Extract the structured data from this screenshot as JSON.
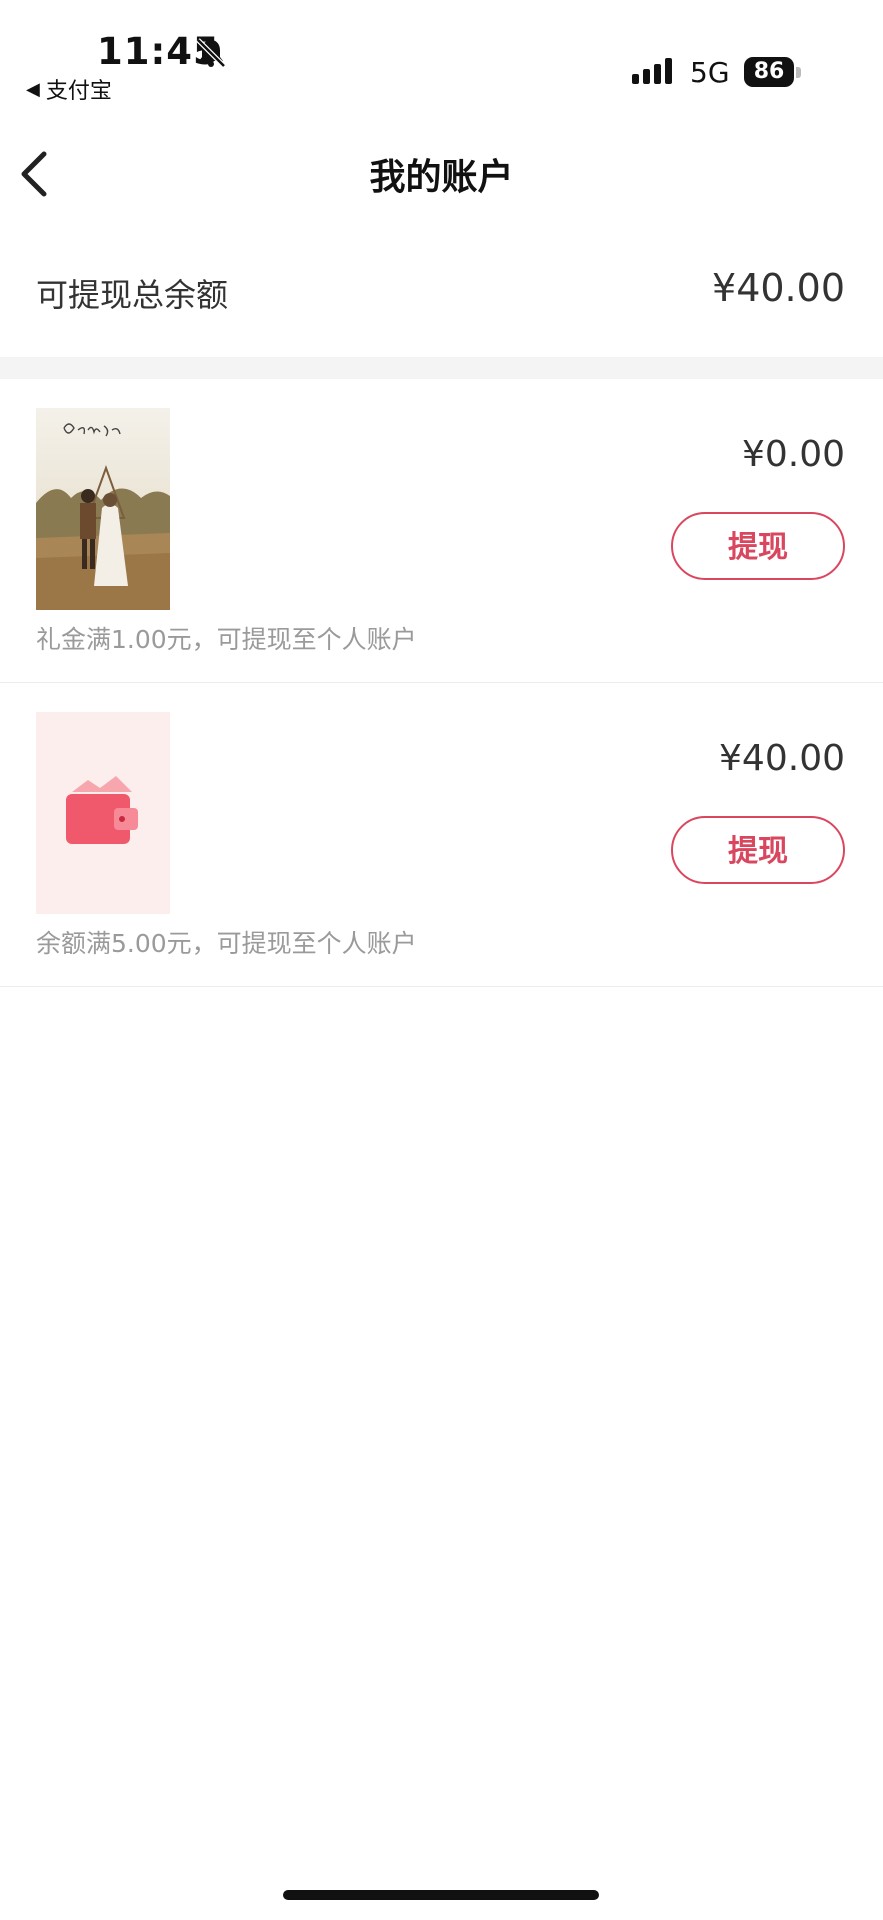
{
  "status_bar": {
    "time": "11:45",
    "back_app": "支付宝",
    "network": "5G",
    "battery": "86",
    "icons": [
      "bell-slash-icon",
      "signal-icon",
      "battery-icon"
    ]
  },
  "nav": {
    "title": "我的账户",
    "back_icon": "chevron-left-icon"
  },
  "summary": {
    "label": "可提现总余额",
    "amount": "¥40.00"
  },
  "accounts": [
    {
      "thumbnail": "wedding-photo",
      "amount": "¥0.00",
      "button": "提现",
      "hint": "礼金满1.00元，可提现至个人账户"
    },
    {
      "thumbnail": "wallet-icon",
      "amount": "¥40.00",
      "button": "提现",
      "hint": "余额满5.00元，可提现至个人账户"
    }
  ],
  "colors": {
    "accent": "#d9475f",
    "wallet": "#f0586b",
    "wallet_bg": "#fdeeee",
    "divider": "#f4f4f4"
  }
}
